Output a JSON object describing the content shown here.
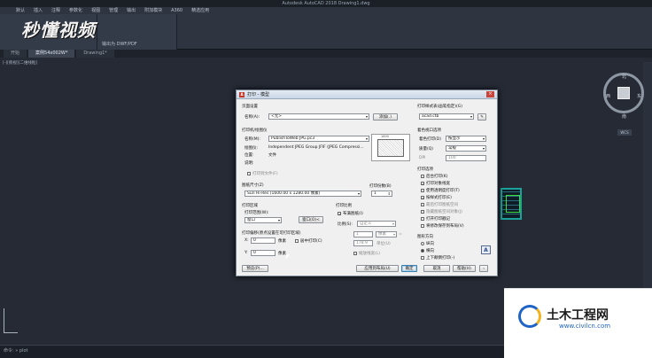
{
  "app": {
    "title": "Autodesk AutoCAD 2018   Drawing1.dwg"
  },
  "menu_tabs": [
    "默认",
    "插入",
    "注释",
    "参数化",
    "视图",
    "管理",
    "输出",
    "附加模块",
    "A360",
    "精选应用"
  ],
  "logo_text": "秒懂视频",
  "ribbon": {
    "output_label": "输出为 DWF/PDF"
  },
  "doc_tabs": [
    "开始",
    "案例54x002W*",
    "Drawing1*"
  ],
  "viewport_label": "[-][俯视][二维线框]",
  "compass": {
    "north": "北",
    "south": "南",
    "east": "东",
    "west": "西",
    "center": "上",
    "wcs": "WCS"
  },
  "cmd": {
    "prompt": "命令:",
    "text": "» plot"
  },
  "dialog": {
    "title": "打印 - 模型",
    "page_setup": {
      "section": "页面设置",
      "name_label": "名称(A):",
      "name_value": "<无>",
      "add_button": "添加(.)"
    },
    "printer": {
      "section": "打印机/绘图仪",
      "name_label": "名称(M):",
      "name_value": "PublishToWeb JPG.pc3",
      "properties_button": "特性(R)",
      "plotter_label": "绘图仪:",
      "plotter_value": "Independent JPEG Group JFIF (JPEG Compressi...",
      "location_label": "位置:",
      "location_value": "文件",
      "desc_label": "说明:",
      "plot_to_file": "打印到文件(F)",
      "preview_dim": "1600"
    },
    "paper_size": {
      "section": "图纸尺寸(Z)",
      "value": "Sun Hi-Res (1600.00 x 1280.00 像素)"
    },
    "copies": {
      "label": "打印份数(B)",
      "value": "1"
    },
    "plot_area": {
      "section": "打印区域",
      "range_label": "打印范围(W):",
      "range_value": "窗口",
      "window_button": "窗口(O)<"
    },
    "plot_offset": {
      "section": "打印偏移(原点设置在可打印区域)",
      "x_label": "X:",
      "x_value": "0",
      "y_label": "Y:",
      "y_value": "0",
      "unit": "像素",
      "center": "居中打印(C)"
    },
    "plot_scale": {
      "section": "打印比例",
      "fit_paper": "布满图纸(I)",
      "scale_label": "比例(S):",
      "scale_value": "自定义",
      "val1": "1",
      "unit1": "像素",
      "val2": "178.9",
      "unit2": "单位(U)",
      "lineweights": "缩放线宽(L)"
    },
    "style_table": {
      "section": "打印样式表(画笔指定)(G)",
      "value": "acad.ctb"
    },
    "shaded": {
      "section": "着色视口选项",
      "shade_label": "着色打印(D)",
      "shade_value": "按显示",
      "quality_label": "质量(Q)",
      "quality_value": "常规",
      "dpi_label": "DPI",
      "dpi_value": "100"
    },
    "options": {
      "section": "打印选项",
      "items": [
        {
          "label": "后台打印(K)",
          "checked": false
        },
        {
          "label": "打印对象线宽",
          "checked": true
        },
        {
          "label": "使用透明度打印(T)",
          "checked": false
        },
        {
          "label": "按样式打印(E)",
          "checked": true
        },
        {
          "label": "最后打印图纸空间",
          "checked": true
        },
        {
          "label": "隐藏图纸空间对象(J)",
          "checked": false
        },
        {
          "label": "打开打印戳记",
          "checked": false
        },
        {
          "label": "将修改保存到布局(V)",
          "checked": false
        }
      ]
    },
    "orientation": {
      "section": "图形方向",
      "portrait": "纵向",
      "landscape": "横向",
      "upside": "上下颠倒打印(-)",
      "selected": "横向"
    },
    "buttons": {
      "preview": "预览(P)...",
      "apply": "应用到布局(U)",
      "ok": "确定",
      "cancel": "取消",
      "help": "帮助(H)"
    }
  },
  "watermark": {
    "title": "土木工程网",
    "url": "www.civilcn.com"
  }
}
